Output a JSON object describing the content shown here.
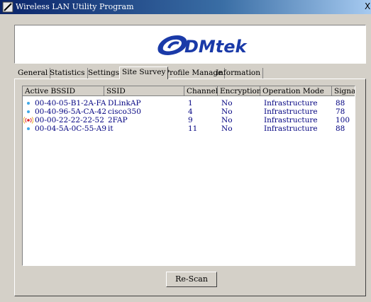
{
  "window": {
    "title": "Wireless LAN Utility Program",
    "close_label": "X"
  },
  "brand": {
    "logo_text": "DMtek"
  },
  "tabs": [
    {
      "label": "General"
    },
    {
      "label": "Statistics"
    },
    {
      "label": "Settings"
    },
    {
      "label": "Site Survey",
      "active": true
    },
    {
      "label": "Profile Manage"
    },
    {
      "label": "Information"
    }
  ],
  "table": {
    "columns": [
      "Active BSSID",
      "SSID",
      "Channel",
      "Encryption",
      "Operation Mode",
      "Signal"
    ],
    "rows": [
      {
        "icon": "network-dot-icon",
        "bssid": "00-40-05-B1-2A-FA",
        "ssid": "DLinkAP",
        "channel": "1",
        "encryption": "No",
        "mode": "Infrastructure",
        "signal": "88"
      },
      {
        "icon": "network-dot-icon",
        "bssid": "00-40-96-5A-CA-42",
        "ssid": "cisco350",
        "channel": "4",
        "encryption": "No",
        "mode": "Infrastructure",
        "signal": "78"
      },
      {
        "icon": "connected-signal-icon",
        "bssid": "00-00-22-22-22-52",
        "ssid": "2FAP",
        "channel": "9",
        "encryption": "No",
        "mode": "Infrastructure",
        "signal": "100"
      },
      {
        "icon": "network-dot-icon",
        "bssid": "00-04-5A-0C-55-A9",
        "ssid": "it",
        "channel": "11",
        "encryption": "No",
        "mode": "Infrastructure",
        "signal": "88"
      }
    ]
  },
  "actions": {
    "rescan_label": "Re-Scan"
  },
  "colors": {
    "list_text": "#000080",
    "dot": "#3fa8e8",
    "connected": "#e02020"
  }
}
